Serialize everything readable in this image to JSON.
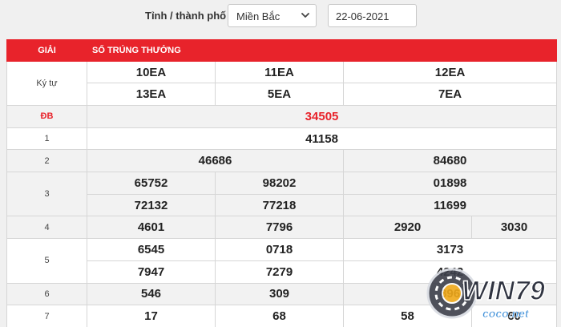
{
  "filter": {
    "label": "Tỉnh / thành phố",
    "region_value": "Miền Bắc",
    "date_value": "22-06-2021"
  },
  "table": {
    "header_prize": "GIẢI",
    "header_numbers": "SỐ TRÚNG THƯỞNG",
    "symbols_label": "Ký tự",
    "symbols": [
      "10EA",
      "11EA",
      "12EA",
      "13EA",
      "5EA",
      "7EA"
    ],
    "special_label": "ĐB",
    "special": "34505",
    "prize1_label": "1",
    "prize1": "41158",
    "prize2_label": "2",
    "prize2": [
      "46686",
      "84680"
    ],
    "prize3_label": "3",
    "prize3": [
      "65752",
      "98202",
      "01898",
      "72132",
      "77218",
      "11699"
    ],
    "prize4_label": "4",
    "prize4": [
      "4601",
      "7796",
      "2920",
      "3030"
    ],
    "prize5_label": "5",
    "prize5": [
      "6545",
      "0718",
      "3173",
      "7947",
      "7279",
      "4242"
    ],
    "prize6_label": "6",
    "prize6": [
      "546",
      "309",
      "896"
    ],
    "prize7_label": "7",
    "prize7": [
      "17",
      "68",
      "58",
      "60"
    ]
  },
  "watermark": {
    "brand": "WIN79",
    "site": "coco.net"
  },
  "colors": {
    "header_red": "#e8232b",
    "special_red": "#e8232b",
    "row_shade": "#f2f2f2"
  }
}
